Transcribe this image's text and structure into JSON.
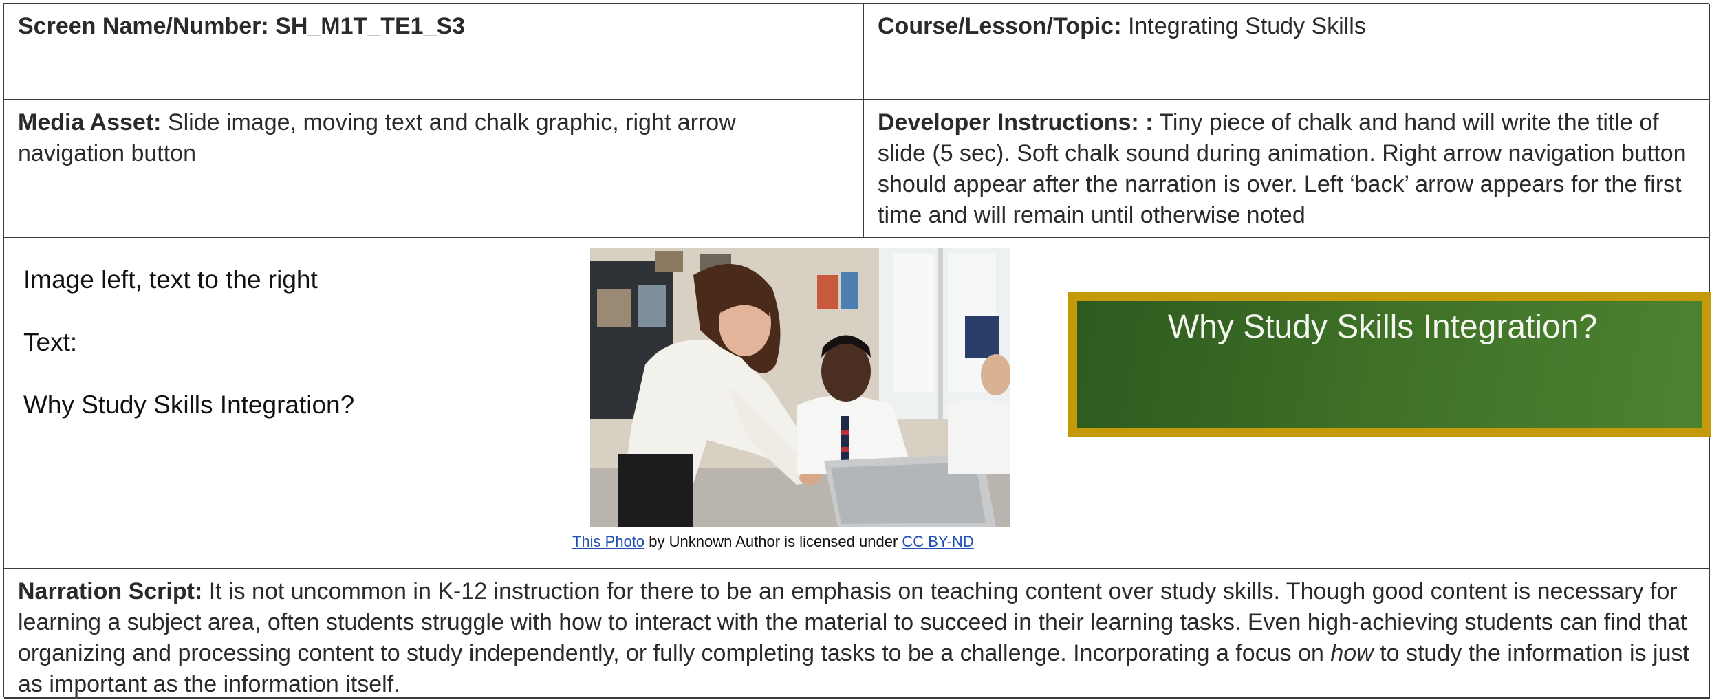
{
  "screen_name": {
    "label": "Screen Name/Number:",
    "value": "SH_M1T_TE1_S3"
  },
  "course": {
    "label": "Course/Lesson/Topic:",
    "value": "Integrating Study Skills"
  },
  "media_asset": {
    "label": "Media Asset:",
    "value": "Slide image, moving text and chalk graphic, right arrow navigation button"
  },
  "developer_instructions": {
    "label": "Developer Instructions: :",
    "value": "Tiny piece of chalk and hand will write the title of slide (5 sec). Soft chalk sound during animation. Right arrow navigation button should appear after the narration is over. Left ‘back’ arrow appears for the first time and will remain until otherwise noted"
  },
  "content": {
    "layout_note": "Image left, text to the right",
    "text_label": "Text:",
    "text_value": "Why Study Skills Integration?"
  },
  "photo_caption": {
    "link_text": "This Photo",
    "middle_text": " by Unknown Author is licensed under ",
    "license_text": "CC BY-ND"
  },
  "chalkboard": {
    "title": "Why Study Skills Integration?",
    "frame_color": "#c49a0a",
    "board_color": "#3d6f26"
  },
  "narration": {
    "label": "Narration Script:",
    "before_emphasis": "It is not uncommon in K-12 instruction for there to be an emphasis on teaching content over study skills. Though good content is necessary for learning a subject area, often students struggle with how to interact with the material to succeed in their learning tasks. Even high-achieving students can find that organizing and processing content to study independently, or fully completing tasks to be a challenge. Incorporating a focus on ",
    "emphasis": "how",
    "after_emphasis": " to study the information is just as important as the information itself."
  }
}
